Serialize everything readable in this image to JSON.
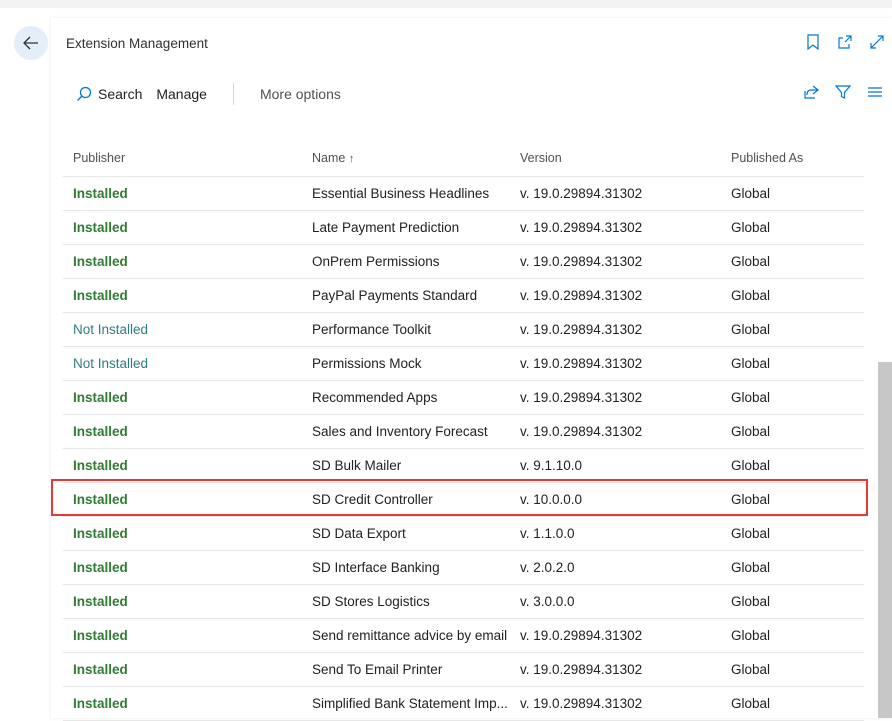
{
  "window": {
    "title": "Extension Management"
  },
  "toolbar": {
    "search_label": "Search",
    "manage_label": "Manage",
    "more_options_label": "More options"
  },
  "columns": {
    "publisher": "Publisher",
    "name": "Name",
    "name_sort_icon": "↑",
    "version": "Version",
    "published_as": "Published As"
  },
  "rows": [
    {
      "status": "Installed",
      "name": "Essential Business Headlines",
      "version": "v. 19.0.29894.31302",
      "published_as": "Global"
    },
    {
      "status": "Installed",
      "name": "Late Payment Prediction",
      "version": "v. 19.0.29894.31302",
      "published_as": "Global"
    },
    {
      "status": "Installed",
      "name": "OnPrem Permissions",
      "version": "v. 19.0.29894.31302",
      "published_as": "Global"
    },
    {
      "status": "Installed",
      "name": "PayPal Payments Standard",
      "version": "v. 19.0.29894.31302",
      "published_as": "Global"
    },
    {
      "status": "Not Installed",
      "name": "Performance Toolkit",
      "version": "v. 19.0.29894.31302",
      "published_as": "Global"
    },
    {
      "status": "Not Installed",
      "name": "Permissions Mock",
      "version": "v. 19.0.29894.31302",
      "published_as": "Global"
    },
    {
      "status": "Installed",
      "name": "Recommended Apps",
      "version": "v. 19.0.29894.31302",
      "published_as": "Global"
    },
    {
      "status": "Installed",
      "name": "Sales and Inventory Forecast",
      "version": "v. 19.0.29894.31302",
      "published_as": "Global"
    },
    {
      "status": "Installed",
      "name": "SD Bulk Mailer",
      "version": "v. 9.1.10.0",
      "published_as": "Global"
    },
    {
      "status": "Installed",
      "name": "SD Credit Controller",
      "version": "v. 10.0.0.0",
      "published_as": "Global"
    },
    {
      "status": "Installed",
      "name": "SD Data Export",
      "version": "v. 1.1.0.0",
      "published_as": "Global"
    },
    {
      "status": "Installed",
      "name": "SD Interface Banking",
      "version": "v. 2.0.2.0",
      "published_as": "Global"
    },
    {
      "status": "Installed",
      "name": "SD Stores Logistics",
      "version": "v. 3.0.0.0",
      "published_as": "Global"
    },
    {
      "status": "Installed",
      "name": "Send remittance advice by email",
      "version": "v. 19.0.29894.31302",
      "published_as": "Global"
    },
    {
      "status": "Installed",
      "name": "Send To Email Printer",
      "version": "v. 19.0.29894.31302",
      "published_as": "Global"
    },
    {
      "status": "Installed",
      "name": "Simplified Bank Statement Imp...",
      "version": "v. 19.0.29894.31302",
      "published_as": "Global"
    }
  ],
  "colors": {
    "installed": "#2e7d32",
    "not_installed": "#2e7d82",
    "highlight": "#e53935",
    "accent": "#0078d4"
  },
  "icons": [
    "back-arrow-icon",
    "bookmark-icon",
    "open-new-window-icon",
    "expand-icon",
    "search-icon",
    "share-icon",
    "filter-icon",
    "list-view-icon"
  ]
}
